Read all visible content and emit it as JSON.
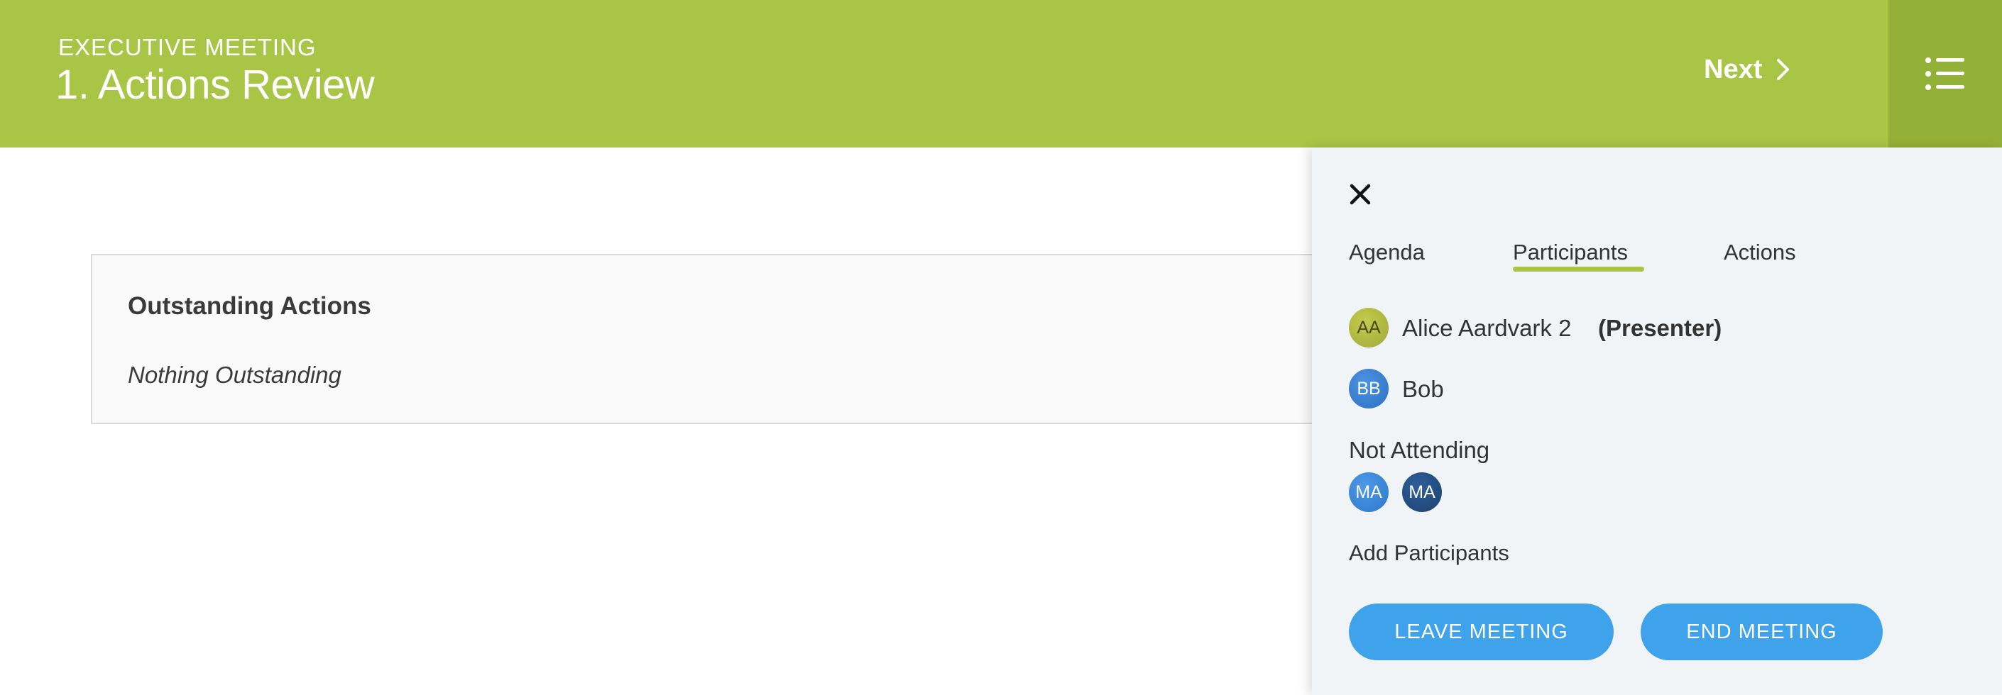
{
  "header": {
    "kicker": "EXECUTIVE MEETING",
    "title": "1. Actions Review",
    "next_label": "Next",
    "background_color": "#a9c545",
    "menu_background_color": "#93b037",
    "next_icon": "chevron-right-icon",
    "menu_icon": "list-menu-icon"
  },
  "main": {
    "card_title": "Outstanding Actions",
    "card_empty_text": "Nothing Outstanding"
  },
  "panel": {
    "close_icon": "close-icon",
    "tabs": [
      {
        "label": "Agenda",
        "active": false
      },
      {
        "label": "Participants",
        "active": true
      },
      {
        "label": "Actions",
        "active": false
      }
    ],
    "participants": [
      {
        "initials": "AA",
        "name": "Alice Aardvark 2",
        "role": "(Presenter)"
      },
      {
        "initials": "BB",
        "name": "Bob"
      }
    ],
    "not_attending_label": "Not Attending",
    "not_attending": [
      {
        "initials": "MA"
      },
      {
        "initials": "MA"
      }
    ],
    "add_participants_label": "Add Participants",
    "leave_button_label": "LEAVE MEETING",
    "end_button_label": "END MEETING",
    "accent_color": "#a9c545",
    "button_color": "#3fa3ec"
  }
}
